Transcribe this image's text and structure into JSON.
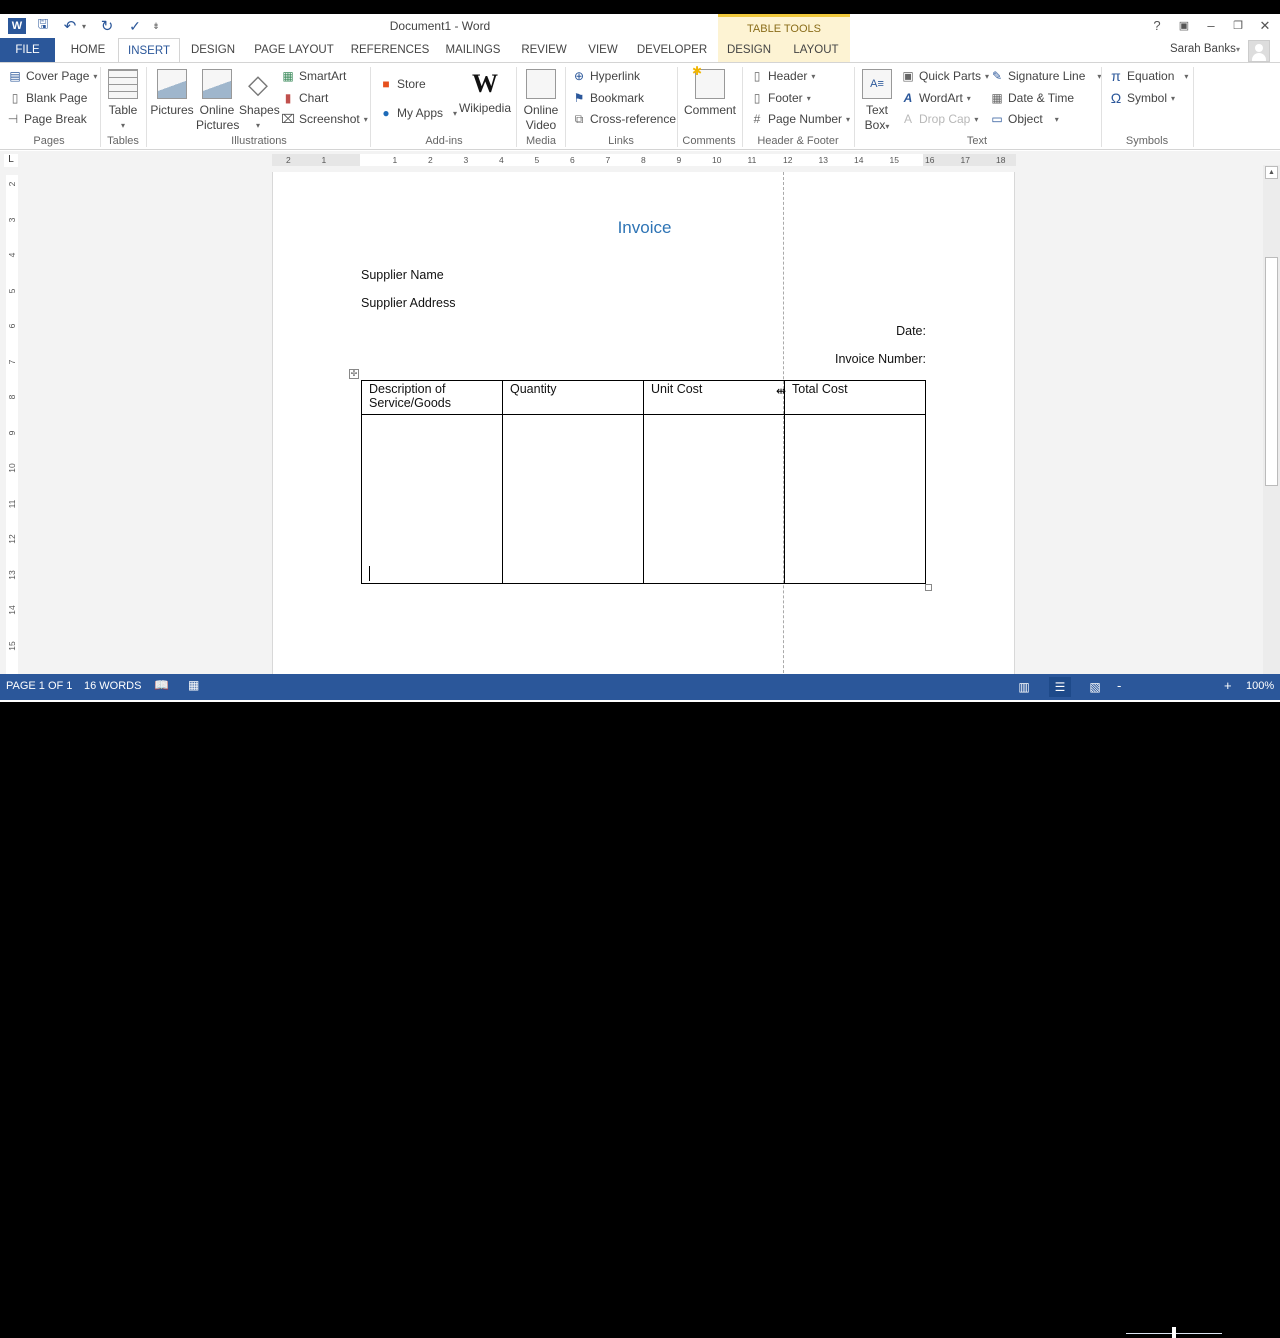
{
  "window": {
    "title": "Document1 - Word",
    "contextual_tab_group": "TABLE TOOLS",
    "controls": {
      "help": "?",
      "ribbon_display": "▣",
      "minimize": "–",
      "restore": "❐",
      "close": "✕"
    }
  },
  "quick_access": {
    "app_icon": "W",
    "save": "🖫",
    "undo": "↶",
    "undo_dropdown": "▾",
    "redo": "↻",
    "spelling": "✓",
    "customize": "⇟"
  },
  "tabs": [
    {
      "label": "FILE"
    },
    {
      "label": "HOME"
    },
    {
      "label": "INSERT",
      "active": true
    },
    {
      "label": "DESIGN"
    },
    {
      "label": "PAGE LAYOUT"
    },
    {
      "label": "REFERENCES"
    },
    {
      "label": "MAILINGS"
    },
    {
      "label": "REVIEW"
    },
    {
      "label": "VIEW"
    },
    {
      "label": "DEVELOPER"
    },
    {
      "label": "DESIGN",
      "contextual": true
    },
    {
      "label": "LAYOUT",
      "contextual": true
    }
  ],
  "user": {
    "name": "Sarah Banks"
  },
  "ribbon": {
    "groups": {
      "pages": {
        "label": "Pages",
        "items": [
          "Cover Page",
          "Blank Page",
          "Page Break"
        ]
      },
      "tables": {
        "label": "Tables",
        "items": [
          "Table"
        ]
      },
      "illustrations": {
        "label": "Illustrations",
        "items": [
          "Pictures",
          "Online",
          "Pictures",
          "Shapes",
          "SmartArt",
          "Chart",
          "Screenshot"
        ]
      },
      "addins": {
        "label": "Add-ins",
        "items": [
          "Store",
          "My Apps",
          "Wikipedia"
        ]
      },
      "media": {
        "label": "Media",
        "items": [
          "Online",
          "Video"
        ]
      },
      "links": {
        "label": "Links",
        "items": [
          "Hyperlink",
          "Bookmark",
          "Cross-reference"
        ]
      },
      "comments": {
        "label": "Comments",
        "items": [
          "Comment"
        ]
      },
      "header_footer": {
        "label": "Header & Footer",
        "items": [
          "Header",
          "Footer",
          "Page Number"
        ]
      },
      "text": {
        "label": "Text",
        "items": [
          "Text",
          "Box",
          "Quick Parts",
          "WordArt",
          "Drop Cap",
          "Signature Line",
          "Date & Time",
          "Object"
        ]
      },
      "symbols": {
        "label": "Symbols",
        "items": [
          "Equation",
          "Symbol"
        ]
      }
    }
  },
  "ruler": {
    "horizontal_ticks": [
      "2",
      "1",
      "1",
      "2",
      "3",
      "4",
      "5",
      "6",
      "7",
      "8",
      "9",
      "10",
      "11",
      "12",
      "13",
      "14",
      "15",
      "16",
      "17",
      "18"
    ],
    "vertical_ticks": [
      "2",
      "3",
      "4",
      "5",
      "6",
      "7",
      "8",
      "9",
      "10",
      "11",
      "12",
      "13",
      "14",
      "15"
    ],
    "tab_selector": "L"
  },
  "document": {
    "title": "Invoice",
    "supplier_name": "Supplier Name",
    "supplier_address": "Supplier Address",
    "date_label": "Date:",
    "invoice_number_label": "Invoice Number:",
    "table": {
      "headers": [
        "Description of Service/Goods",
        "Quantity",
        "Unit Cost",
        "Total Cost"
      ],
      "rows": [
        [
          "",
          "",
          "",
          ""
        ]
      ]
    }
  },
  "statusbar": {
    "page": "PAGE 1 OF 1",
    "words": "16 WORDS",
    "zoom": "100%",
    "zoom_minus": "-",
    "zoom_plus": "+",
    "zoom_percent": 100
  }
}
